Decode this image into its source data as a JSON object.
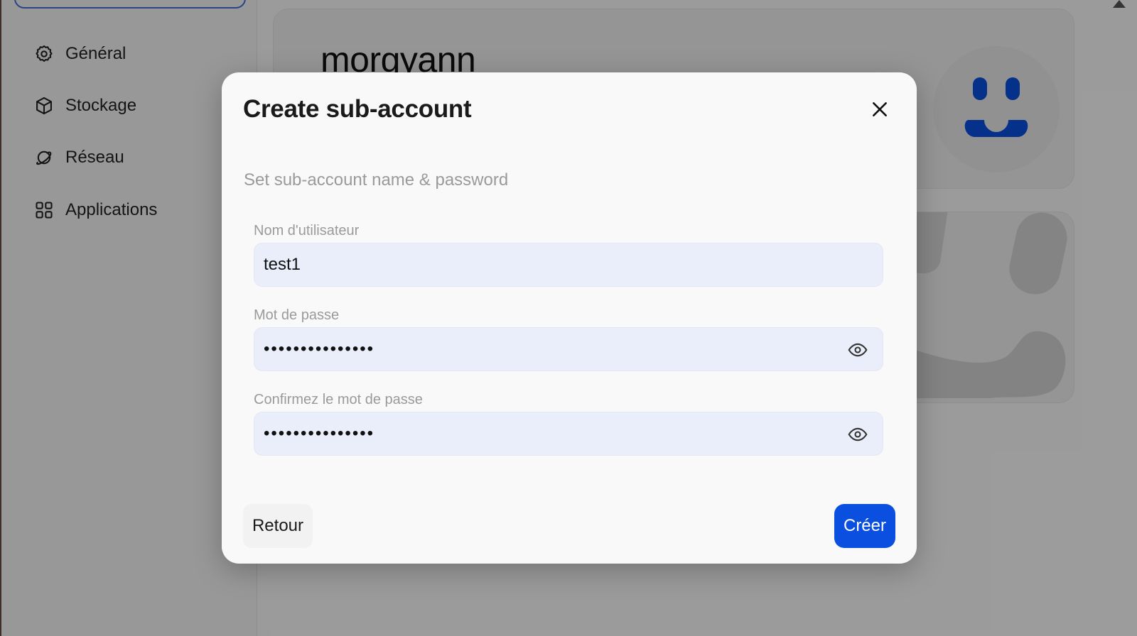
{
  "sidebar": {
    "items": [
      {
        "label": "Général",
        "icon": "gear-icon"
      },
      {
        "label": "Stockage",
        "icon": "cube-icon"
      },
      {
        "label": "Réseau",
        "icon": "planet-icon"
      },
      {
        "label": "Applications",
        "icon": "grid-icon"
      }
    ]
  },
  "profile": {
    "username": "morgyann",
    "avatar_icon": "smiley-face-icon",
    "avatar_color": "#0a4fe0"
  },
  "modal": {
    "title": "Create sub-account",
    "subtitle": "Set sub-account name & password",
    "username_label": "Nom d'utilisateur",
    "username_value": "test1",
    "password_label": "Mot de passe",
    "password_value": "•••••••••••••••",
    "confirm_label": "Confirmez le mot de passe",
    "confirm_value": "•••••••••••••••",
    "back_label": "Retour",
    "create_label": "Créer"
  },
  "colors": {
    "accent": "#0a4fe0",
    "input_bg": "#e9eefa"
  }
}
